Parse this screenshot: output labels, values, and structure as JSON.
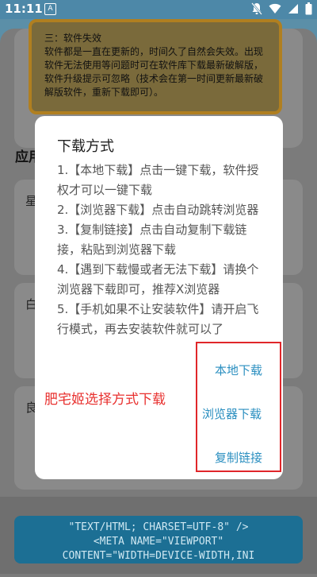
{
  "status_bar": {
    "time": "11:11",
    "app_badge": "A"
  },
  "background": {
    "notice_lines": [
      "三：软件失效",
      "软件都是一直在更新的，时间久了自然会失效。出现软件无法使用等问题时可在软件库下载最新破解版，软件升级提示可忽略（技术会在第一时间更新最新破解版软件，重新下载即可）。"
    ],
    "section_title": "应用",
    "items": [
      {
        "label": "星"
      },
      {
        "label": "白"
      },
      {
        "label": "良"
      }
    ],
    "bottom_code": [
      "\"TEXT/HTML; CHARSET=UTF-8\" />",
      "<META NAME=\"VIEWPORT\"",
      "CONTENT=\"WIDTH=DEVICE-WIDTH,INI"
    ]
  },
  "dialog": {
    "title": "下载方式",
    "lines": [
      "1.【本地下载】点击一键下载，软件授权才可以一键下载",
      "2.【浏览器下载】点击自动跳转浏览器",
      "3.【复制链接】点击自动复制下载链接，粘贴到浏览器下载",
      "4.【遇到下载慢或者无法下载】请换个浏览器下载即可，推荐X浏览器",
      "5.【手机如果不让安装软件】请开启飞行模式，再去安装软件就可以了"
    ],
    "buttons": {
      "local": "本地下载",
      "browser": "浏览器下载",
      "copy": "复制链接"
    }
  },
  "annotation": "肥宅姬选择方式下载",
  "colors": {
    "accent_blue": "#2b8fc0",
    "annotation_red": "#e8312f",
    "status_bar": "#4d88a8"
  }
}
